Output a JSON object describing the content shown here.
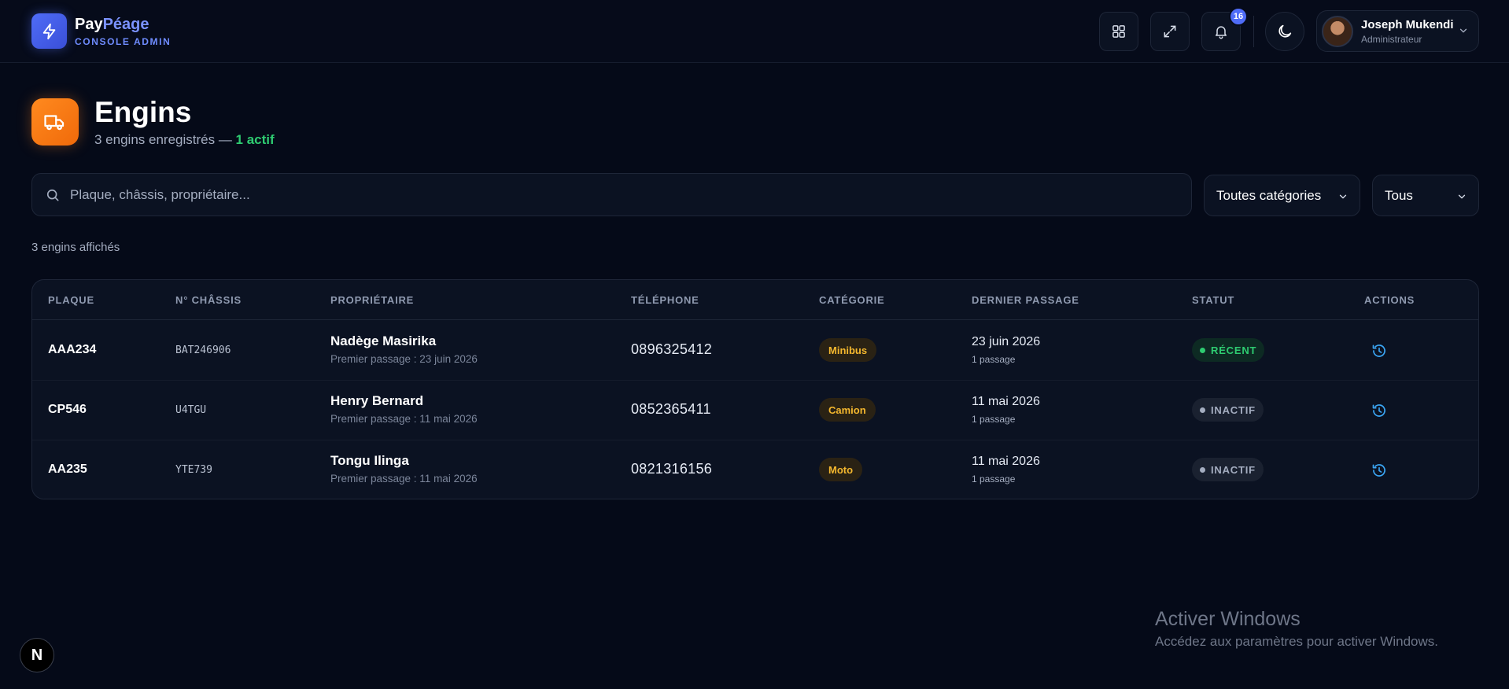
{
  "brand": {
    "name_part1": "Pay",
    "name_part2": "Péage",
    "subtitle": "CONSOLE ADMIN"
  },
  "topbar": {
    "notifications_count": "16",
    "user": {
      "name": "Joseph Mukendi",
      "role": "Administrateur"
    }
  },
  "page": {
    "title": "Engins",
    "subtitle_prefix": "3 engins enregistrés — ",
    "subtitle_active": "1 actif",
    "count_text": "3 engins affichés"
  },
  "filters": {
    "search_placeholder": "Plaque, châssis, propriétaire...",
    "category_selected": "Toutes catégories",
    "status_selected": "Tous"
  },
  "table": {
    "headers": [
      "PLAQUE",
      "N° CHÂSSIS",
      "PROPRIÉTAIRE",
      "TÉLÉPHONE",
      "CATÉGORIE",
      "DERNIER PASSAGE",
      "STATUT",
      "ACTIONS"
    ],
    "rows": [
      {
        "plate": "AAA234",
        "chassis": "BAT246906",
        "owner": "Nadège Masirika",
        "first_pass": "Premier passage : 23 juin 2026",
        "phone": "0896325412",
        "category": "Minibus",
        "last_date": "23 juin 2026",
        "last_count": "1 passage",
        "status": "RÉCENT"
      },
      {
        "plate": "CP546",
        "chassis": "U4TGU",
        "owner": "Henry Bernard",
        "first_pass": "Premier passage : 11 mai 2026",
        "phone": "0852365411",
        "category": "Camion",
        "last_date": "11 mai 2026",
        "last_count": "1 passage",
        "status": "INACTIF"
      },
      {
        "plate": "AA235",
        "chassis": "YTE739",
        "owner": "Tongu Ilinga",
        "first_pass": "Premier passage : 11 mai 2026",
        "phone": "0821316156",
        "category": "Moto",
        "last_date": "11 mai 2026",
        "last_count": "1 passage",
        "status": "INACTIF"
      }
    ]
  },
  "overlay": {
    "watermark_title": "Activer Windows",
    "watermark_sub": "Accédez aux paramètres pour activer Windows.",
    "next_badge": "N"
  },
  "colors": {
    "background": "#050a18",
    "accent": "#4f6cf7",
    "page_icon": "#ff8a1f",
    "active_green": "#2ecc71",
    "category_badge": "#f5b82e",
    "action_icon": "#3ba6f5"
  },
  "icons": [
    "bolt-icon",
    "grid-icon",
    "expand-icon",
    "bell-icon",
    "moon-icon",
    "chevron-down-icon",
    "truck-icon",
    "search-icon",
    "history-icon"
  ]
}
